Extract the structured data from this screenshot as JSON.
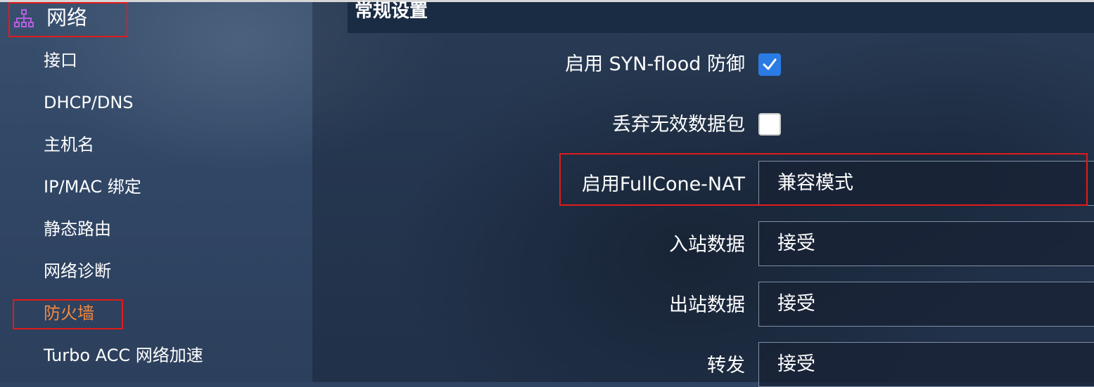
{
  "sidebar": {
    "section_title": "网络",
    "section_icon": "network-icon",
    "items": [
      {
        "label": "接口"
      },
      {
        "label": "DHCP/DNS"
      },
      {
        "label": "主机名"
      },
      {
        "label": "IP/MAC 绑定"
      },
      {
        "label": "静态路由"
      },
      {
        "label": "网络诊断"
      },
      {
        "label": "防火墙",
        "active": true
      },
      {
        "label": "Turbo ACC 网络加速"
      }
    ]
  },
  "main": {
    "section_title": "常规设置",
    "fields": {
      "syn_flood": {
        "label": "启用 SYN-flood 防御",
        "checked": true
      },
      "drop_invalid": {
        "label": "丢弃无效数据包",
        "checked": false
      },
      "fullcone_nat": {
        "label": "启用FullCone-NAT",
        "value": "兼容模式"
      },
      "input": {
        "label": "入站数据",
        "value": "接受"
      },
      "output": {
        "label": "出站数据",
        "value": "接受"
      },
      "forward": {
        "label": "转发",
        "value": "接受"
      }
    }
  },
  "colors": {
    "active_nav": "#f4893e",
    "highlight_border": "#e11b1b",
    "checkbox_checked": "#2b7be4",
    "icon_purple": "#b65fe0"
  }
}
